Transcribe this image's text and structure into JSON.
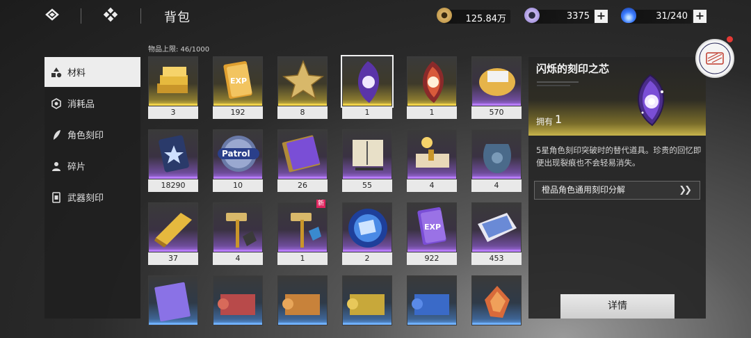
{
  "header": {
    "title": "背包",
    "icons": [
      "layers-icon",
      "diamond-grid-icon"
    ]
  },
  "resources": [
    {
      "name": "coin",
      "icon": "coin-icon",
      "value": "125.84万",
      "color": "#d9b36a"
    },
    {
      "name": "crystal",
      "icon": "crystal-ring-icon",
      "value": "3375",
      "color": "#c9b8f0"
    },
    {
      "name": "stamina",
      "icon": "blue-flame-icon",
      "value": "31/240",
      "color": "#3a7bff"
    }
  ],
  "sidebar": {
    "items": [
      {
        "label": "材料",
        "icon": "shapes-icon",
        "active": true
      },
      {
        "label": "消耗品",
        "icon": "hexagon-icon",
        "active": false
      },
      {
        "label": "角色刻印",
        "icon": "feather-icon",
        "active": false
      },
      {
        "label": "碎片",
        "icon": "person-icon",
        "active": false
      },
      {
        "label": "武器刻印",
        "icon": "card-icon",
        "active": false
      }
    ]
  },
  "capacity": "物品上限: 46/1000",
  "items": [
    {
      "count": "3",
      "rarity": "gold",
      "art": "gold-ingots-icon"
    },
    {
      "count": "192",
      "rarity": "gold",
      "art": "exp-card-gold-icon"
    },
    {
      "count": "8",
      "rarity": "gold",
      "art": "gold-star-icon"
    },
    {
      "count": "1",
      "rarity": "gold",
      "art": "purple-leaf-core-icon",
      "selected": true
    },
    {
      "count": "1",
      "rarity": "gold",
      "art": "red-leaf-core-icon"
    },
    {
      "count": "570",
      "rarity": "purple",
      "art": "yarn-spool-icon"
    },
    {
      "count": "18290",
      "rarity": "purple",
      "art": "blue-badge-icon"
    },
    {
      "count": "10",
      "rarity": "purple",
      "art": "patrol-coin-icon",
      "label": "Patrol"
    },
    {
      "count": "26",
      "rarity": "purple",
      "art": "purple-book-icon"
    },
    {
      "count": "55",
      "rarity": "purple",
      "art": "scroll-book-icon"
    },
    {
      "count": "4",
      "rarity": "purple",
      "art": "golden-scroll-icon"
    },
    {
      "count": "4",
      "rarity": "purple",
      "art": "blue-bag-icon"
    },
    {
      "count": "37",
      "rarity": "purple",
      "art": "gold-bar-icon"
    },
    {
      "count": "4",
      "rarity": "purple",
      "art": "gold-hammer-icon"
    },
    {
      "count": "1",
      "rarity": "purple",
      "art": "gold-hammer-blue-icon",
      "new": "新"
    },
    {
      "count": "2",
      "rarity": "purple",
      "art": "blue-orb-icon"
    },
    {
      "count": "922",
      "rarity": "purple",
      "art": "exp-card-purple-icon"
    },
    {
      "count": "453",
      "rarity": "purple",
      "art": "blue-map-icon"
    },
    {
      "count": "",
      "rarity": "blue",
      "art": "violet-book-icon"
    },
    {
      "count": "",
      "rarity": "blue",
      "art": "red-scroll-icon"
    },
    {
      "count": "",
      "rarity": "blue",
      "art": "orange-scroll-icon"
    },
    {
      "count": "",
      "rarity": "blue",
      "art": "yellow-scroll-icon"
    },
    {
      "count": "",
      "rarity": "blue",
      "art": "blue-scroll-icon"
    },
    {
      "count": "",
      "rarity": "blue",
      "art": "orange-shard-icon"
    }
  ],
  "exp_label": "EXP",
  "detail": {
    "title": "闪烁的刻印之芯",
    "owned_label": "拥有",
    "owned_count": "1",
    "description": "5星角色刻印突破时的替代道具。珍贵的回忆即便出现裂痕也不会轻易消失。",
    "dismantle_label": "橙品角色通用刻印分解",
    "arrow": "»",
    "details_button": "详情"
  },
  "colors": {
    "gold": "#f0d24a",
    "purple": "#b87cff",
    "blue": "#6fb0ff",
    "new_badge": "#e0245e"
  }
}
